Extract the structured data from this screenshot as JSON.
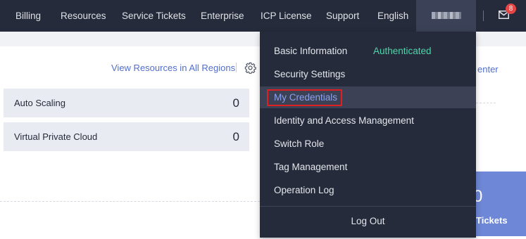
{
  "topnav": {
    "items": [
      "Billing",
      "Resources",
      "Service Tickets",
      "Enterprise",
      "ICP License",
      "Support",
      "English"
    ],
    "notification_count": "8"
  },
  "main": {
    "view_link": "View Resources in All Regions",
    "resources": [
      {
        "label": "Auto Scaling",
        "count": "0"
      },
      {
        "label": "Virtual Private Cloud",
        "count": "0"
      }
    ]
  },
  "right_panel": {
    "link_fragment": "enter",
    "banner_number": "0",
    "banner_text": "Tickets"
  },
  "dropdown": {
    "basic_info_label": "Basic Information",
    "auth_status": "Authenticated",
    "items": [
      "Security Settings",
      "My Credentials",
      "Identity and Access Management",
      "Switch Role",
      "Tag Management",
      "Operation Log"
    ],
    "logout_label": "Log Out",
    "highlight_color": "#e02020",
    "auth_color": "#50d4ab"
  }
}
